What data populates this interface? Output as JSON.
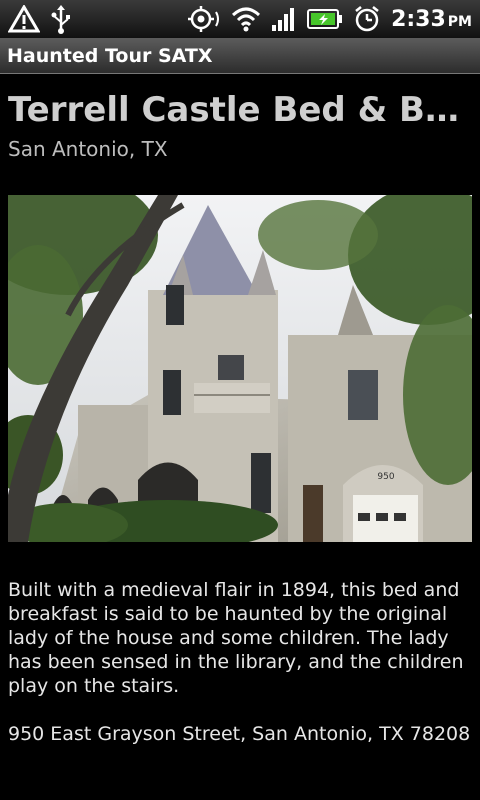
{
  "status_bar": {
    "time": "2:33",
    "ampm": "PM",
    "icons": [
      "warning-icon",
      "usb-icon",
      "gps-icon",
      "wifi-icon",
      "signal-icon",
      "battery-charging-icon",
      "alarm-icon"
    ]
  },
  "app": {
    "title": "Haunted Tour SATX"
  },
  "place": {
    "title": "Terrell Castle Bed & Brea...",
    "city": "San Antonio, TX",
    "description": "Built with a medieval flair in 1894, this bed and breakfast is said to be haunted by the original lady of the house and some children. The lady has been sensed in the library, and the children play on the stairs.",
    "address": "950 East Grayson Street, San Antonio, TX 78208",
    "photo_garage_number": "950"
  },
  "colors": {
    "background": "#000000",
    "title_text": "#cfcfcf",
    "body_text": "#e6e6e6",
    "battery": "#47c62a"
  }
}
